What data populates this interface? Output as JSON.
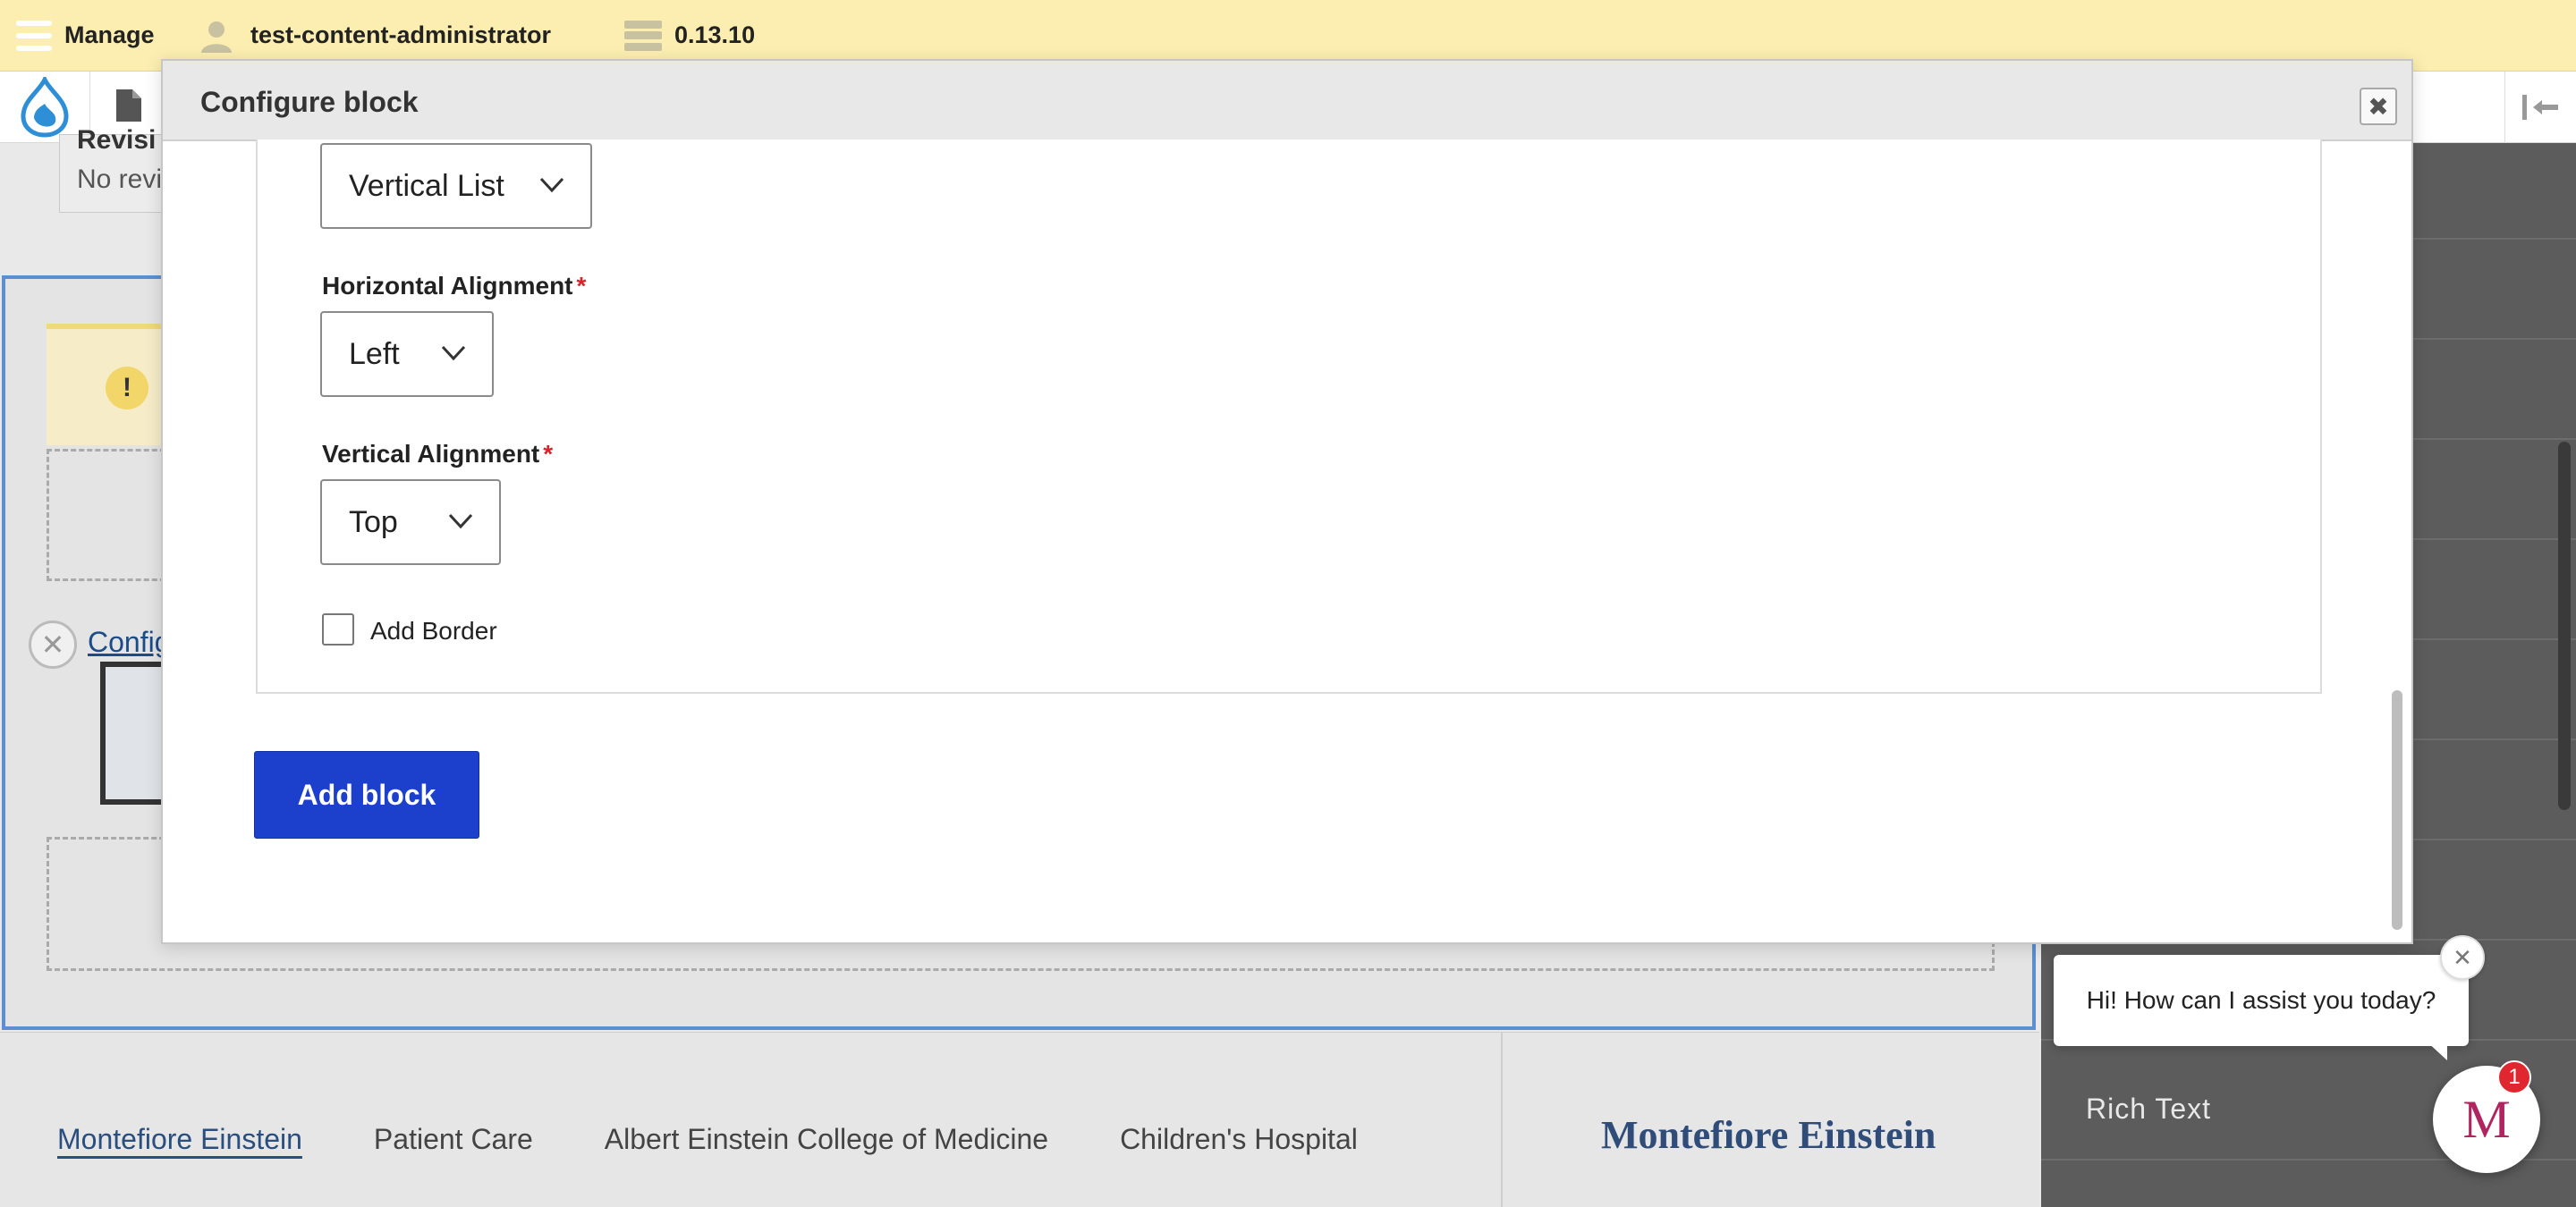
{
  "toolbar": {
    "manage_label": "Manage",
    "user_label": "test-content-administrator",
    "version_label": "0.13.10"
  },
  "background": {
    "revision_title": "Revisi",
    "revision_text": "No revi",
    "warning_symbol": "!",
    "configure_link": "Config",
    "remove_symbol": "✕",
    "sidebar_item": "Rich Text"
  },
  "modal": {
    "title": "Configure block",
    "close_symbol": "✖",
    "list_style": {
      "value": "Vertical List"
    },
    "horizontal_alignment": {
      "label": "Horizontal Alignment",
      "required_mark": "*",
      "value": "Left"
    },
    "vertical_alignment": {
      "label": "Vertical Alignment",
      "required_mark": "*",
      "value": "Top"
    },
    "add_border": {
      "label": "Add Border",
      "checked": false
    },
    "submit_label": "Add block"
  },
  "footer": {
    "links": [
      "Montefiore Einstein",
      "Patient Care",
      "Albert Einstein College of Medicine",
      "Children's Hospital"
    ],
    "brand": "Montefiore Einstein"
  },
  "chat": {
    "greeting": "Hi! How can I assist you today?",
    "close_symbol": "✕",
    "launcher_letter": "M",
    "badge_count": "1"
  },
  "colors": {
    "toolbar_bg": "#fbeeb0",
    "primary_button": "#1c3fcc",
    "required": "#d9222a",
    "drupal_blue": "#2f8fd6",
    "chat_brand": "#b0245f"
  }
}
